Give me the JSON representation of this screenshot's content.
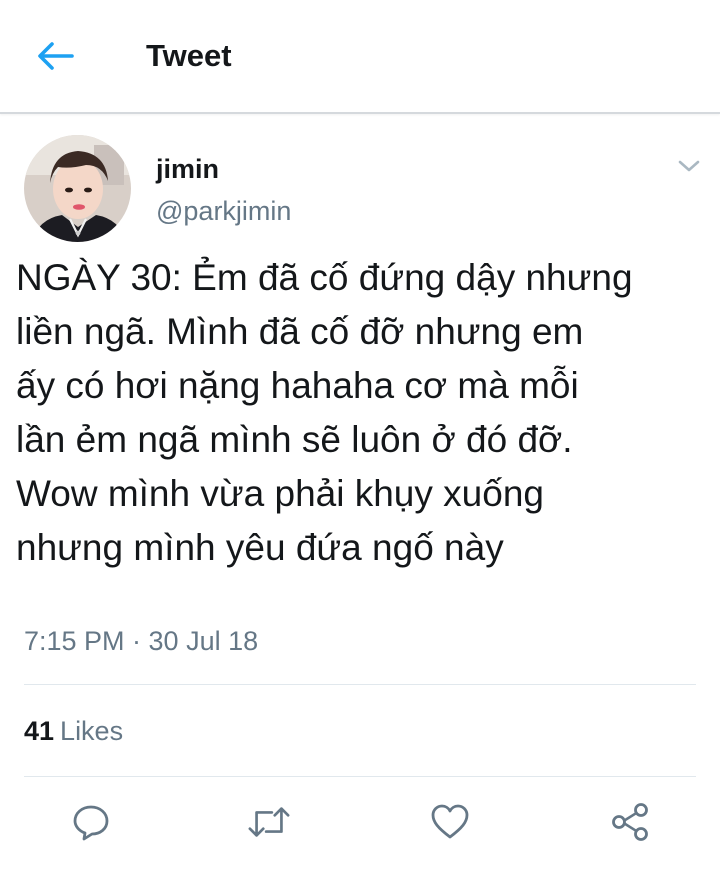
{
  "header": {
    "title": "Tweet",
    "back_icon": "arrow-left-icon",
    "accent_color": "#1da1f2"
  },
  "author": {
    "display_name": "jimin",
    "handle": "@parkjimin",
    "avatar_icon": "profile-photo"
  },
  "tweet": {
    "text": "NGÀY 30: Ẻm đã cố đứng dậy nhưng\nliền ngã. Mình đã cố đỡ nhưng em\nấy có hơi nặng hahaha cơ mà mỗi\nlần ẻm ngã mình sẽ luôn ở đó đỡ.\nWow mình vừa phải khụy xuống\nnhưng mình yêu đứa ngố này",
    "timestamp": "7:15 PM · 30 Jul 18",
    "likes_count": "41",
    "likes_label": "Likes"
  },
  "actions": [
    {
      "name": "reply",
      "icon": "reply-icon"
    },
    {
      "name": "retweet",
      "icon": "retweet-icon"
    },
    {
      "name": "like",
      "icon": "heart-icon"
    },
    {
      "name": "share",
      "icon": "share-icon"
    }
  ],
  "colors": {
    "text": "#14171a",
    "secondary_text": "#657786",
    "divider": "#e1e8ed"
  }
}
